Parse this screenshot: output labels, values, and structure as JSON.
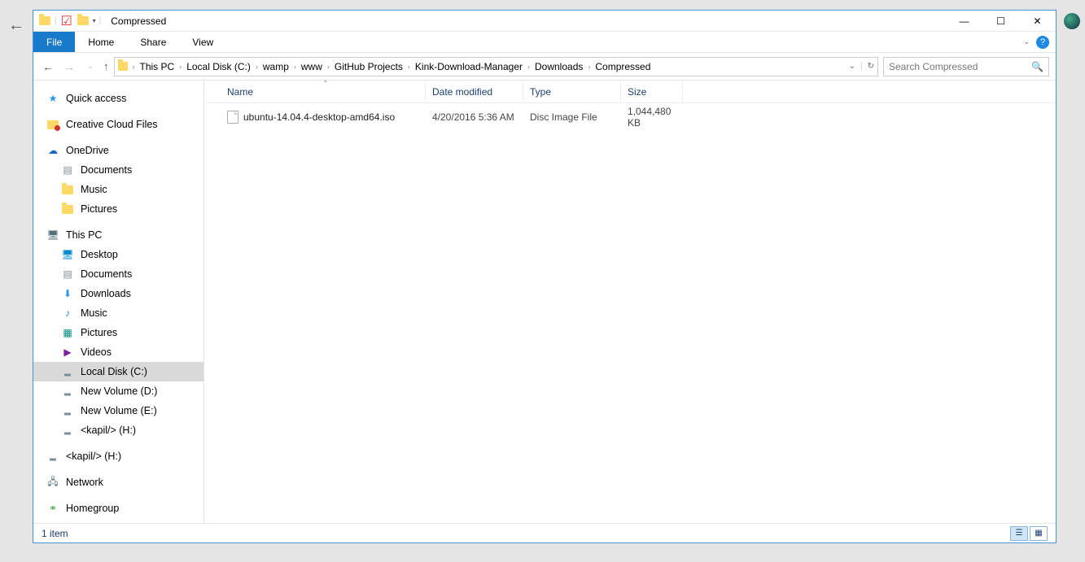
{
  "window": {
    "title": "Compressed"
  },
  "ribbon": {
    "file": "File",
    "home": "Home",
    "share": "Share",
    "view": "View"
  },
  "breadcrumbs": [
    "This PC",
    "Local Disk (C:)",
    "wamp",
    "www",
    "GitHub Projects",
    "Kink-Download-Manager",
    "Downloads",
    "Compressed"
  ],
  "search": {
    "placeholder": "Search Compressed"
  },
  "columns": {
    "name": "Name",
    "date": "Date modified",
    "type": "Type",
    "size": "Size"
  },
  "files": [
    {
      "name": "ubuntu-14.04.4-desktop-amd64.iso",
      "date": "4/20/2016 5:36 AM",
      "type": "Disc Image File",
      "size": "1,044,480 KB"
    }
  ],
  "nav": {
    "quick": "Quick access",
    "cc": "Creative Cloud Files",
    "onedrive": "OneDrive",
    "od_docs": "Documents",
    "od_music": "Music",
    "od_pics": "Pictures",
    "thispc": "This PC",
    "desktop": "Desktop",
    "docs": "Documents",
    "downloads": "Downloads",
    "music": "Music",
    "pics": "Pictures",
    "videos": "Videos",
    "drive_c": "Local Disk (C:)",
    "drive_d": "New Volume (D:)",
    "drive_e": "New Volume (E:)",
    "drive_h": "<kapil/> (H:)",
    "drive_h2": "<kapil/> (H:)",
    "network": "Network",
    "homegroup": "Homegroup"
  },
  "status": {
    "count": "1 item"
  }
}
